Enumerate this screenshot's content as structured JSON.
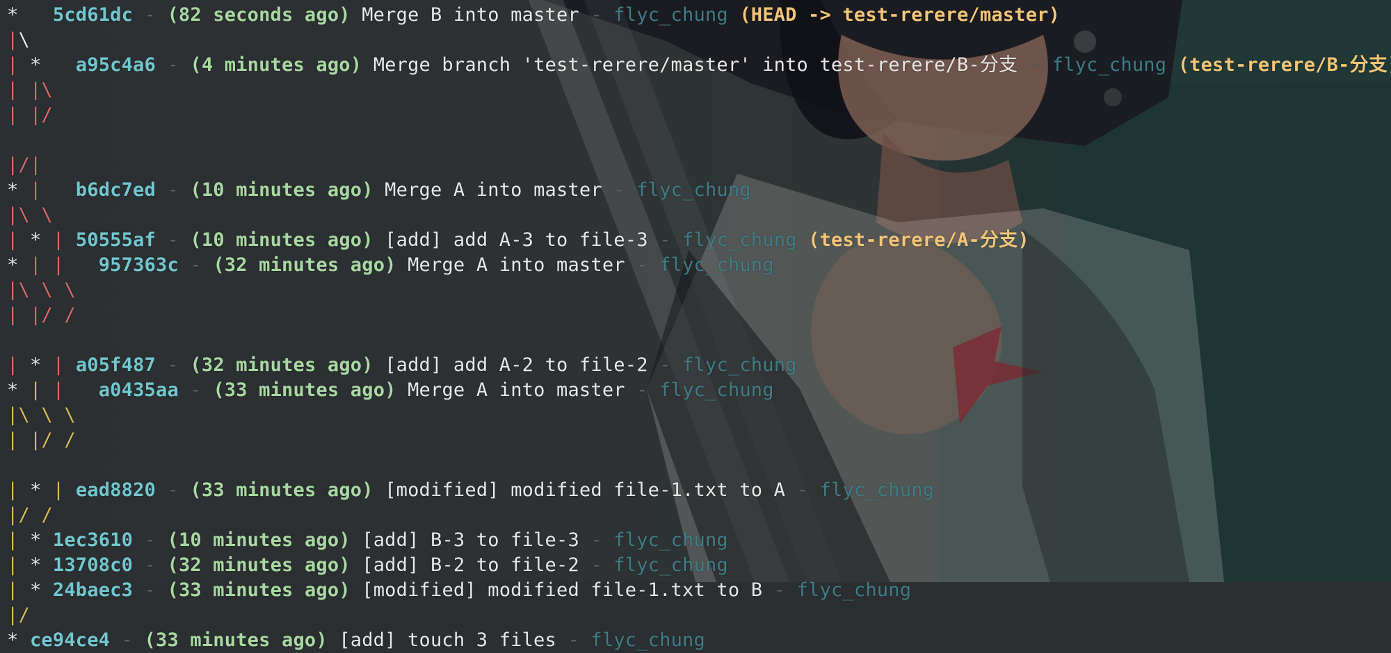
{
  "colors": {
    "hash": "#72c7cf",
    "time": "#a9d8a2",
    "author": "#3f7d86",
    "refs": "#f3c677",
    "graph_red": "#d86b6b",
    "graph_yellow": "#d9ba5a",
    "text": "#e8e8e8"
  },
  "commits": {
    "c1": {
      "hash": "5cd61dc",
      "time": "(82 seconds ago)",
      "message": "Merge B into master",
      "author": "flyc_chung",
      "refs": "(HEAD -> test-rerere/master)"
    },
    "c2": {
      "hash": "a95c4a6",
      "time": "(4 minutes ago)",
      "message": "Merge branch 'test-rerere/master' into test-rerere/B-分支",
      "author": "flyc_chung",
      "refs": "(test-rerere/B-分支)"
    },
    "c3": {
      "hash": "b6dc7ed",
      "time": "(10 minutes ago)",
      "message": "Merge A into master",
      "author": "flyc_chung"
    },
    "c4": {
      "hash": "50555af",
      "time": "(10 minutes ago)",
      "message": "[add] add A-3 to file-3",
      "author": "flyc_chung",
      "refs": "(test-rerere/A-分支)"
    },
    "c5": {
      "hash": "957363c",
      "time": "(32 minutes ago)",
      "message": "Merge A into master",
      "author": "flyc_chung"
    },
    "c6": {
      "hash": "a05f487",
      "time": "(32 minutes ago)",
      "message": "[add] add A-2 to file-2",
      "author": "flyc_chung"
    },
    "c7": {
      "hash": "a0435aa",
      "time": "(33 minutes ago)",
      "message": "Merge A into master",
      "author": "flyc_chung"
    },
    "c8": {
      "hash": "ead8820",
      "time": "(33 minutes ago)",
      "message": "[modified] modified file-1.txt to A",
      "author": "flyc_chung"
    },
    "c9": {
      "hash": "1ec3610",
      "time": "(10 minutes ago)",
      "message": "[add] B-3 to file-3",
      "author": "flyc_chung"
    },
    "c10": {
      "hash": "13708c0",
      "time": "(32 minutes ago)",
      "message": "[add] B-2 to file-2",
      "author": "flyc_chung"
    },
    "c11": {
      "hash": "24baec3",
      "time": "(33 minutes ago)",
      "message": "[modified] modified file-1.txt to B",
      "author": "flyc_chung"
    },
    "c12": {
      "hash": "ce94ce4",
      "time": "(33 minutes ago)",
      "message": "[add] touch 3 files",
      "author": "flyc_chung"
    }
  },
  "glyphs": {
    "star": "*",
    "pipe": "|",
    "slash": "/",
    "backslash": "\\",
    "separator": "-"
  }
}
